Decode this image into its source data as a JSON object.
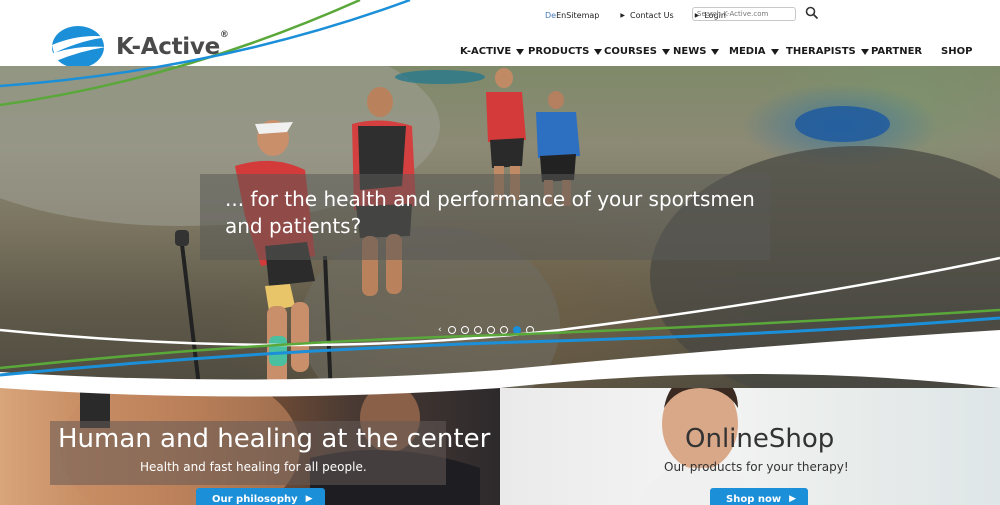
{
  "brand": {
    "name": "K-Active",
    "registered": "®",
    "colors": {
      "blue": "#1b8fd8",
      "green": "#5aa83a",
      "text": "#4a4a4a"
    }
  },
  "toplinks": {
    "language": {
      "de": "De",
      "separator": "",
      "en": "En"
    },
    "sitemap": "Sitemap",
    "contact": "Contact Us",
    "login": "Login"
  },
  "search": {
    "placeholder": "Search K-Active.com",
    "icon": "search-icon"
  },
  "nav": {
    "items": [
      {
        "label": "K-ACTIVE",
        "dropdown": true
      },
      {
        "label": "PRODUCTS",
        "dropdown": true
      },
      {
        "label": "COURSES",
        "dropdown": true
      },
      {
        "label": "NEWS",
        "dropdown": true
      },
      {
        "label": "MEDIA",
        "dropdown": true
      },
      {
        "label": "THERAPISTS",
        "dropdown": true
      },
      {
        "label": "PARTNER",
        "dropdown": false
      },
      {
        "label": "SHOP",
        "dropdown": false
      }
    ]
  },
  "hero": {
    "caption_line1": "... for the health and performance of your sportsmen",
    "caption_line2": "and patients?",
    "slides": {
      "count": 7,
      "active_index": 6
    }
  },
  "promos": {
    "left": {
      "title": "Human and healing at the center",
      "subtitle": "Health and fast healing for all people.",
      "button": "Our philosophy"
    },
    "right": {
      "title": "OnlineShop",
      "subtitle": "Our products for your therapy!",
      "button": "Shop now"
    }
  }
}
